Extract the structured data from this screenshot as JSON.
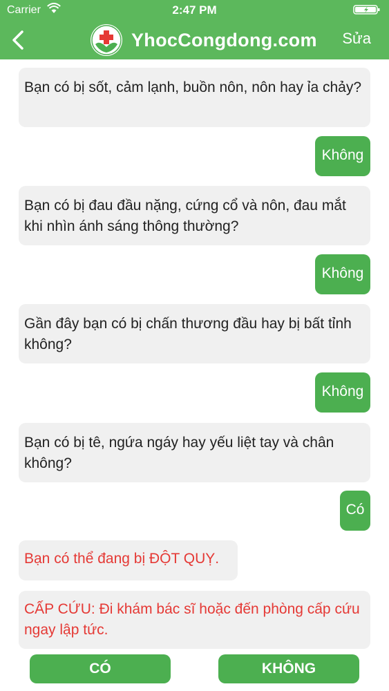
{
  "status_bar": {
    "carrier": "Carrier",
    "time": "2:47 PM"
  },
  "header": {
    "brand": "YhocCongdong.com",
    "edit_label": "Sửa",
    "back_icon": "chevron-left-icon",
    "logo_icon": "medical-cross-logo-icon",
    "background_color": "#5cb85c"
  },
  "conversation": {
    "questions": [
      "Bạn có bị sốt, cảm lạnh, buồn nôn, nôn hay ỉa chảy?",
      "Bạn có bị đau đầu nặng, cứng cổ và nôn, đau mắt khi nhìn ánh sáng thông thường?",
      "Gần đây bạn có bị chấn thương đầu hay bị bất tỉnh không?",
      "Bạn có bị tê, ngứa ngáy hay yếu liệt tay và chân không?"
    ],
    "answers": [
      "Không",
      "Không",
      "Không",
      "Có"
    ],
    "results": [
      "Bạn có thể đang bị ĐỘT QUỴ.",
      "CẤP CỨU: Đi khám bác sĩ hoặc đến phòng cấp cứu ngay lập tức."
    ],
    "answer_color": "#4caf50",
    "result_text_color": "#e53935"
  },
  "actions": {
    "yes_label": "CÓ",
    "no_label": "KHÔNG"
  }
}
